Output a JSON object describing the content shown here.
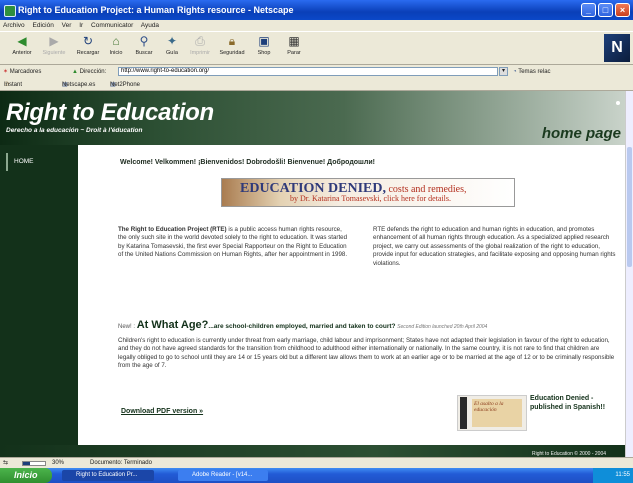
{
  "window": {
    "title": "Right to Education Project: a Human Rights resource - Netscape"
  },
  "menubar": [
    "Archivo",
    "Edición",
    "Ver",
    "Ir",
    "Communicator",
    "Ayuda"
  ],
  "toolbar": {
    "buttons": [
      {
        "label": "Anterior",
        "icon": "back-arrow-icon"
      },
      {
        "label": "Siguiente",
        "icon": "forward-arrow-icon"
      },
      {
        "label": "Recargar",
        "icon": "reload-icon"
      },
      {
        "label": "Inicio",
        "icon": "home-icon"
      },
      {
        "label": "Buscar",
        "icon": "search-icon"
      },
      {
        "label": "Guía",
        "icon": "guide-icon"
      },
      {
        "label": "Imprimir",
        "icon": "print-icon"
      },
      {
        "label": "Seguridad",
        "icon": "lock-icon"
      },
      {
        "label": "Shop",
        "icon": "shop-icon"
      },
      {
        "label": "Parar",
        "icon": "stop-icon"
      }
    ],
    "logo": "N"
  },
  "location": {
    "bookmarks_label": "Marcadores",
    "address_label": "Dirección:",
    "url": "http://www.right-to-education.org/",
    "related_label": "Temas relac"
  },
  "personal_toolbar": [
    "Instant Message",
    "Netscape.es",
    "Net2Phone"
  ],
  "banner": {
    "title": "Right to Education",
    "subtitle": "Derecho a la educación  ~  Droit à l'éducation",
    "section": "home page"
  },
  "sidebar": {
    "items": [
      "HOME"
    ]
  },
  "content": {
    "welcome": "Welcome! Velkommen! ¡Bienvenidos! Dobrodošli! Bienvenue! Добродошли!",
    "ad": {
      "title": "EDUCATION DENIED,",
      "title_rest": " costs and remedies,",
      "subtitle": "by Dr. Katarina Tomasevski, click here for details."
    },
    "left_para_bold": "The Right to Education Project (RTE)",
    "left_para": " is a public access human rights resource, the only such site in the world devoted solely to the right to education. It was started by Katarina Tomasevski, the first ever Special Rapporteur on the Right to Education of the United Nations Commission on Human Rights, after her appointment in 1998.",
    "right_para": "RTE defends the right to education and human rights in education, and promotes enhancement of all human rights through education. As a specialized applied research project, we carry out assessments of the global realization of the right to education, provide input for education strategies, and facilitate exposing and opposing human rights violations.",
    "new_label": "New! :",
    "new_title": "At What Age?",
    "new_title_rest": "...are school-children employed, married and taken to court?",
    "new_note": "Second Edition launched 20th April 2004",
    "body_para": "Children's right to education is currently under threat from early marriage, child labour and imprisonment; States have not adapted their legislation in favour of the right to education, and they do not have agreed standards for the transition from childhood to adulthood either internationally or nationally. In the same country, it is not rare to find that children are legally obliged to go to school until they are 14 or 15 years old but a different law allows them to work at an earlier age or to be married at the age of 12 or to be criminally responsible from the age of 7.",
    "download": "Download PDF version »",
    "book_caption": "Education Denied - published in Spanish!!",
    "book_cover": "El asalto a la educación",
    "copyright": "Right to Education © 2000 - 2004"
  },
  "statusbar": {
    "progress_percent": 30,
    "progress_text": "30%",
    "status": "Documento: Terminado"
  },
  "taskbar": {
    "start": "Inicio",
    "tasks": [
      "Right to Education Pr...",
      "Adobe Reader - [v14..."
    ],
    "clock": "11:55"
  }
}
